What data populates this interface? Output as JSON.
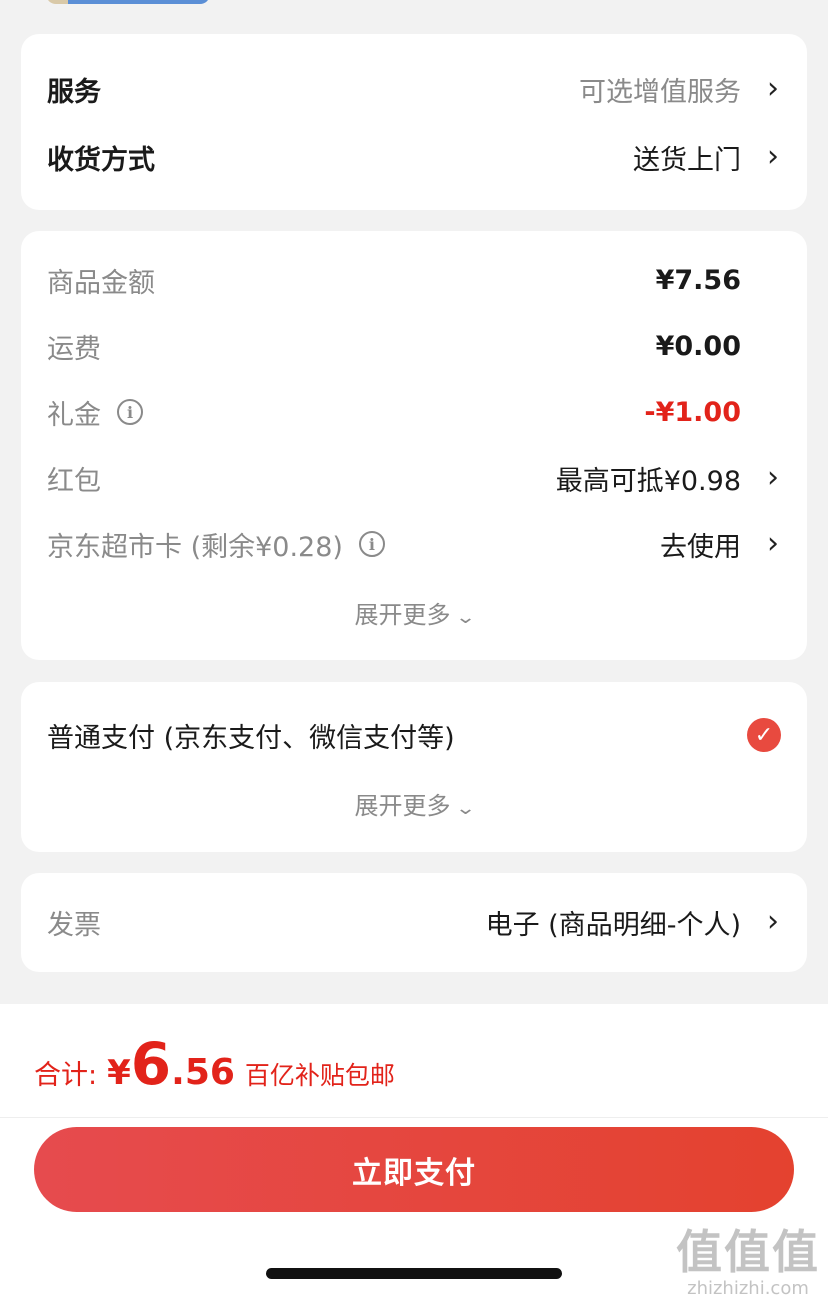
{
  "service_card": {
    "service_label": "服务",
    "service_value": "可选增值服务",
    "delivery_label": "收货方式",
    "delivery_value": "送货上门"
  },
  "price_card": {
    "goods_amount_label": "商品金额",
    "goods_amount_value": "¥7.56",
    "shipping_label": "运费",
    "shipping_value": "¥0.00",
    "gift_label": "礼金",
    "gift_value": "-¥1.00",
    "redpacket_label": "红包",
    "redpacket_value": "最高可抵¥0.98",
    "card_label": "京东超市卡 (剩余¥0.28)",
    "card_value": "去使用",
    "expand_label": "展开更多"
  },
  "payment_card": {
    "method_label": "普通支付 (京东支付、微信支付等)",
    "expand_label": "展开更多"
  },
  "invoice_card": {
    "label": "发票",
    "value": "电子 (商品明细-个人)"
  },
  "footer": {
    "total_label": "合计:",
    "currency": "¥",
    "total_int": "6",
    "total_dec": ".56",
    "subsidy_tag": "百亿补贴包邮",
    "pay_button": "立即支付"
  },
  "watermark": {
    "big": "值值值",
    "small": "zhizhizhi.com"
  },
  "colors": {
    "accent_red": "#e2231a",
    "button_gradient_start": "#e64b4e",
    "button_gradient_end": "#e4422f"
  }
}
